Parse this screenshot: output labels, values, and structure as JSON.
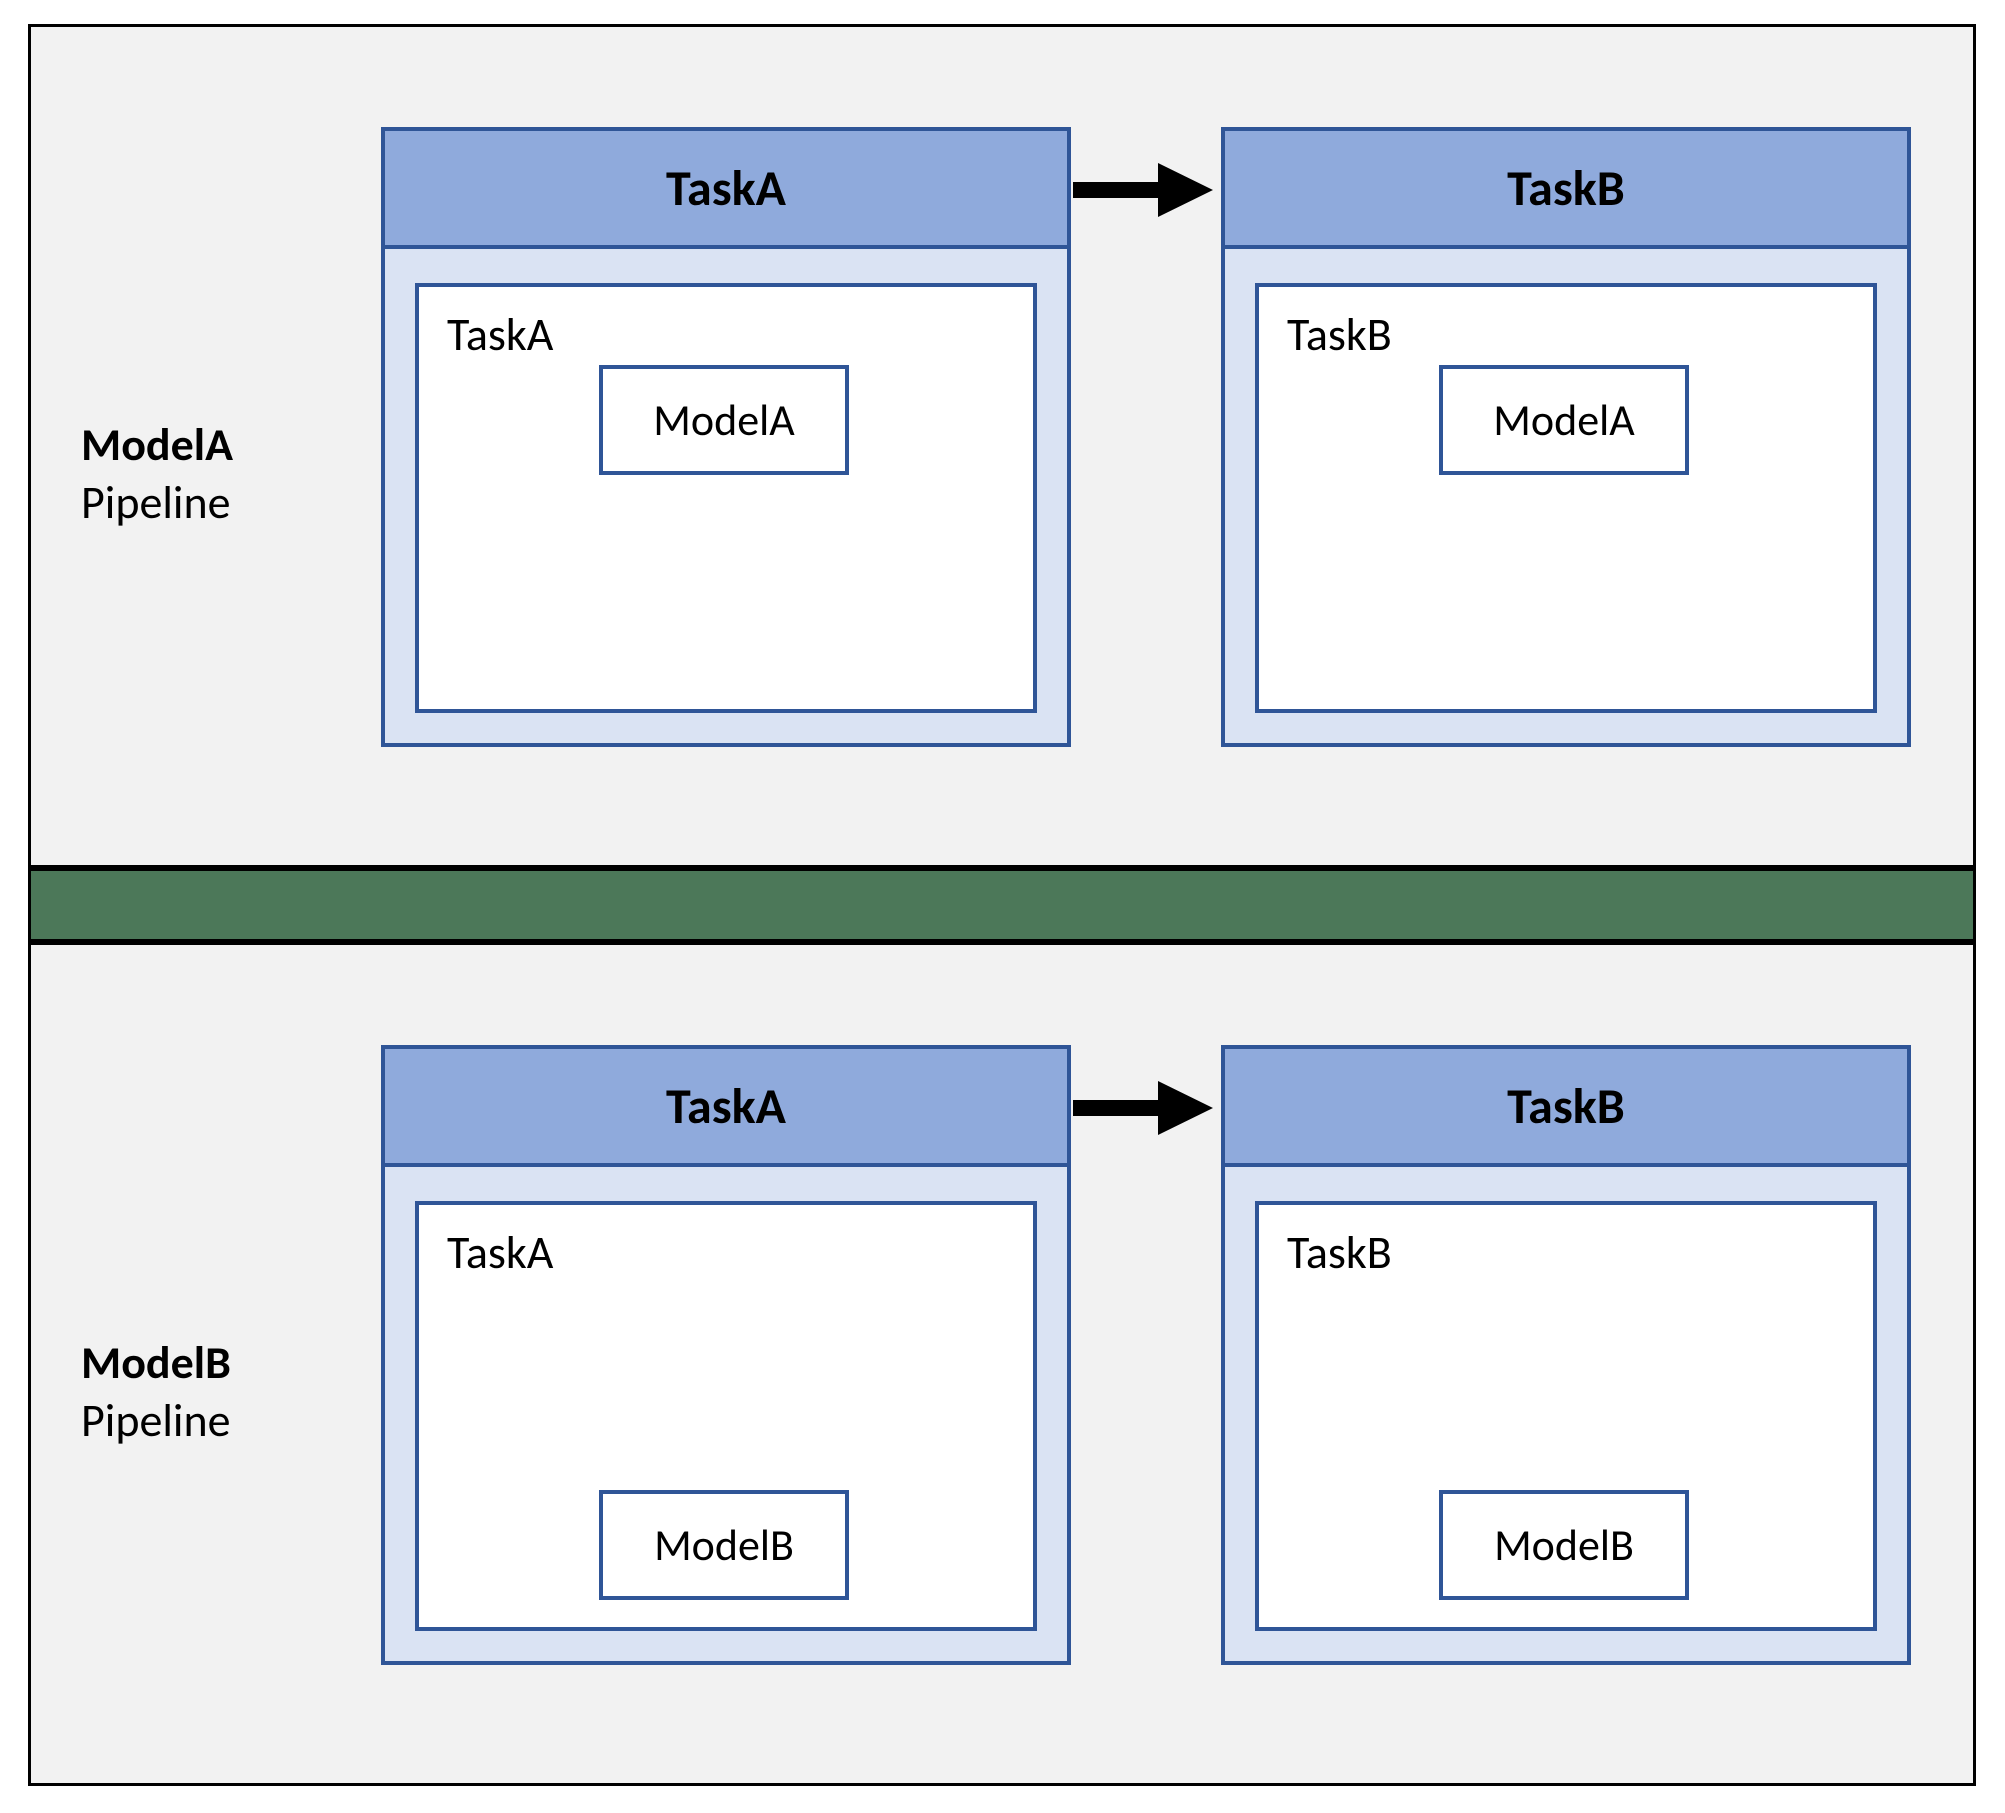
{
  "pipelines": [
    {
      "label_bold": "ModelA",
      "label_normal": "Pipeline",
      "tasks": [
        {
          "header": "TaskA",
          "body_label": "TaskA",
          "model_label": "ModelA",
          "model_pos": "upper"
        },
        {
          "header": "TaskB",
          "body_label": "TaskB",
          "model_label": "ModelA",
          "model_pos": "upper"
        }
      ]
    },
    {
      "label_bold": "ModelB",
      "label_normal": "Pipeline",
      "tasks": [
        {
          "header": "TaskA",
          "body_label": "TaskA",
          "model_label": "ModelB",
          "model_pos": "lower"
        },
        {
          "header": "TaskB",
          "body_label": "TaskB",
          "model_label": "ModelB",
          "model_pos": "lower"
        }
      ]
    }
  ]
}
